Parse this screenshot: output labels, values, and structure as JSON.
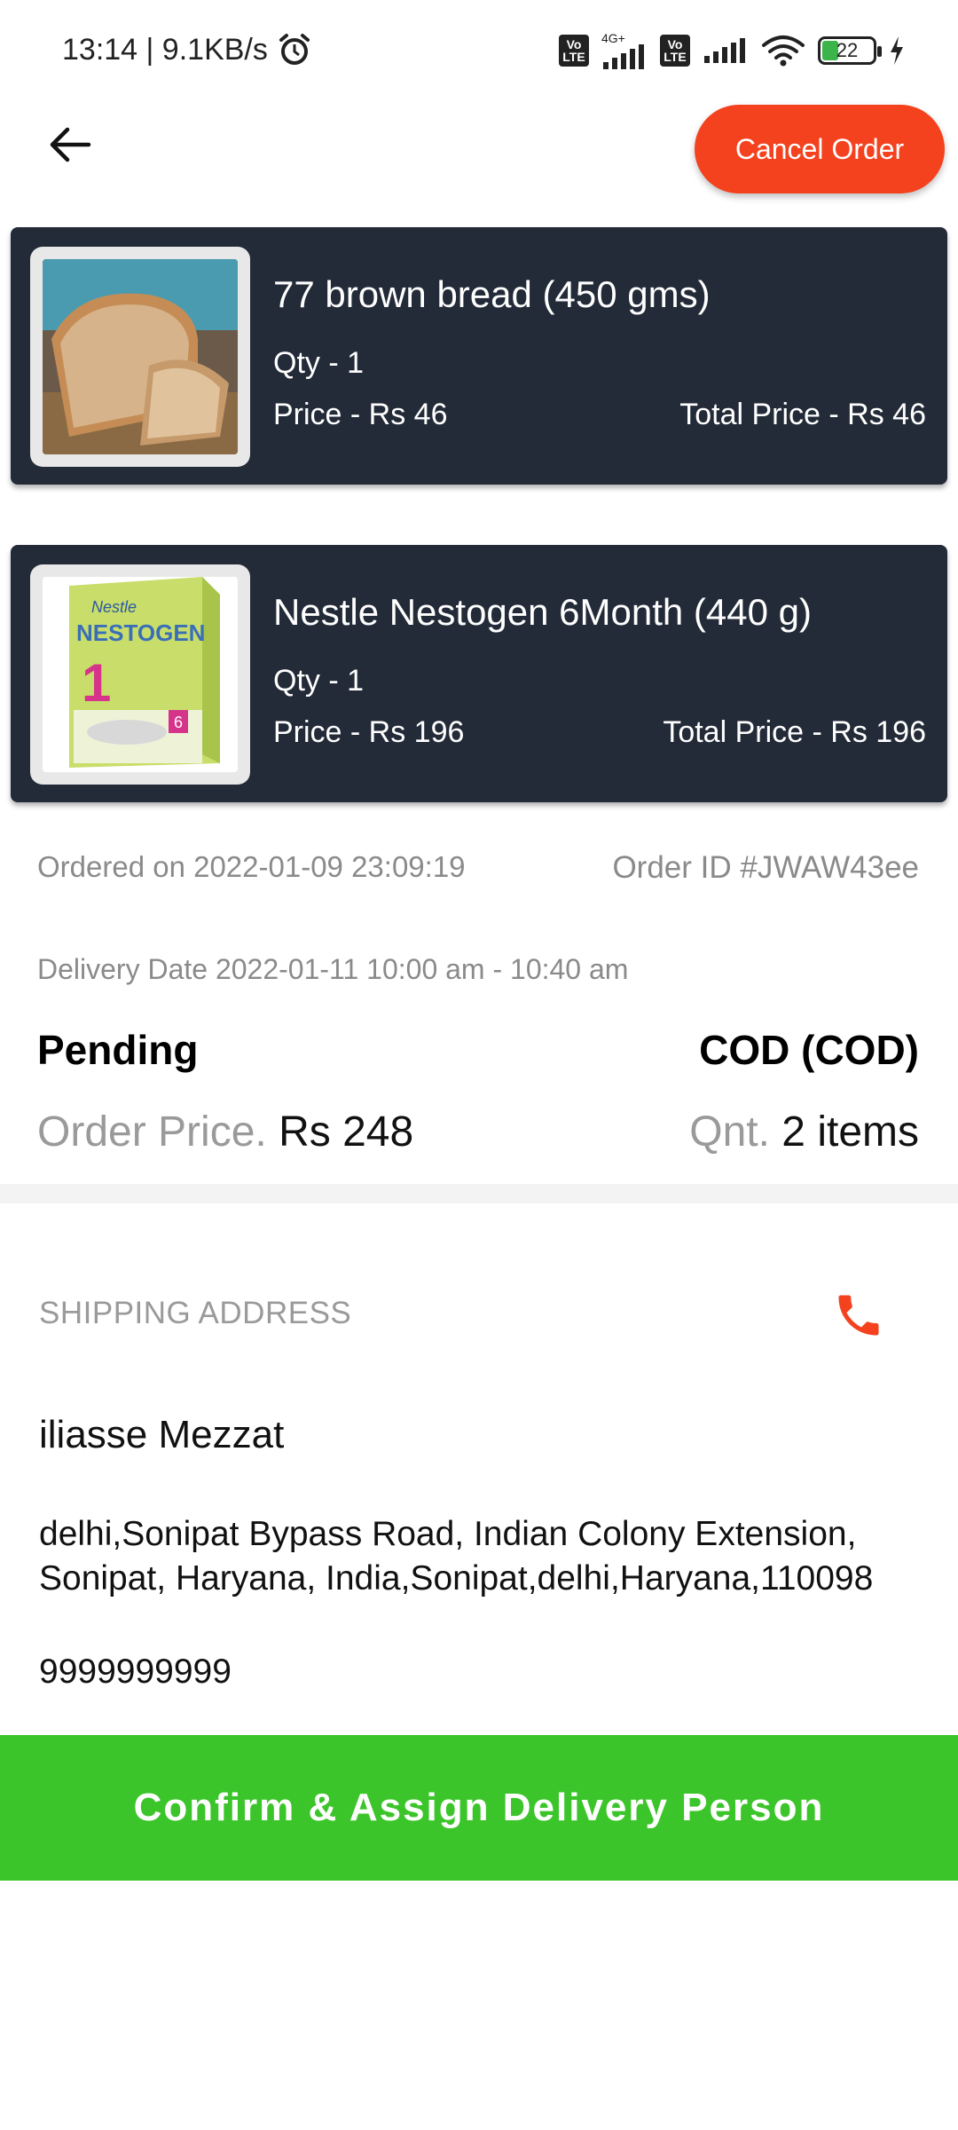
{
  "status_bar": {
    "time_speed": "13:14 | 9.1KB/s",
    "network_type": "4G+",
    "volte_label": "Vo LTE",
    "battery": "22",
    "icons": [
      "alarm-icon",
      "signal-icon",
      "wifi-icon",
      "battery-icon",
      "charging-icon"
    ]
  },
  "header": {
    "back_icon": "arrow-left-icon",
    "cancel_label": "Cancel Order"
  },
  "colors": {
    "accent_orange": "#f4411e",
    "card_bg": "#232b38",
    "confirm_green": "#3cc52a"
  },
  "products": [
    {
      "name": "77 brown bread (450 gms)",
      "qty": "Qty - 1",
      "price": "Price - Rs 46",
      "total": "Total Price - Rs 46"
    },
    {
      "name": "Nestle Nestogen 6Month (440 g)",
      "qty": "Qty - 1",
      "price": "Price - Rs 196",
      "total": "Total Price - Rs 196",
      "box_brand": "Nestle",
      "box_title": "NESTOGEN",
      "box_number": "1",
      "box_badge": "6"
    }
  ],
  "order": {
    "ordered_on": "Ordered on 2022-01-09 23:09:19",
    "order_id": "Order ID #JWAW43ee",
    "delivery_date": "Delivery Date 2022-01-11 10:00 am - 10:40 am",
    "status": "Pending",
    "payment": "COD (COD)",
    "price_label": "Order Price.",
    "price_value": "Rs 248",
    "qty_label": "Qnt.",
    "qty_value": "2 items"
  },
  "shipping": {
    "label": "SHIPPING ADDRESS",
    "name": "iliasse Mezzat",
    "address": "delhi,Sonipat Bypass Road, Indian Colony Extension, Sonipat, Haryana, India,Sonipat,delhi,Haryana,110098",
    "phone": "9999999999"
  },
  "confirm_label": "Confirm & Assign Delivery Person"
}
